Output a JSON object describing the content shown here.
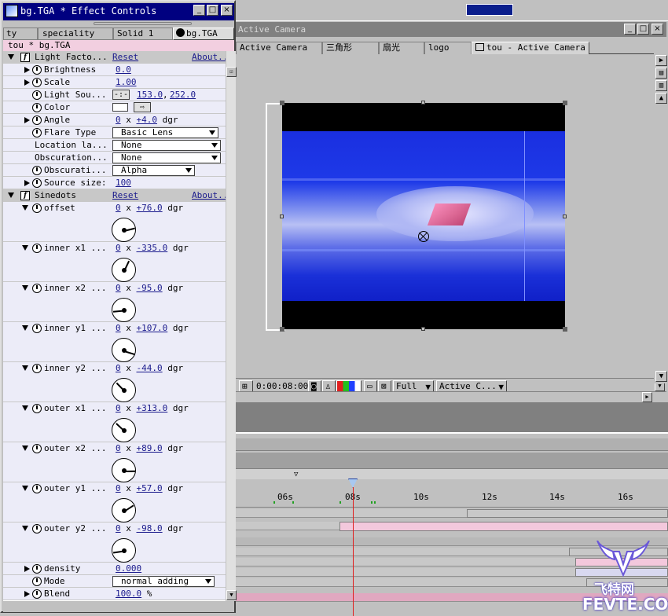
{
  "effect_controls": {
    "title": "bg.TGA * Effect Controls",
    "tabs": [
      {
        "label": "ty"
      },
      {
        "label": "speciality"
      },
      {
        "label": "Solid 1"
      },
      {
        "label": "bg.TGA"
      }
    ],
    "layer_path": "tou * bg.TGA",
    "light_factory": {
      "name": "Light Facto...",
      "reset": "Reset",
      "about": "About...",
      "params": {
        "brightness": {
          "label": "Brightness",
          "value": "0.0"
        },
        "scale": {
          "label": "Scale",
          "value": "1.00"
        },
        "light_source": {
          "label": "Light Sou...",
          "x": "153.0",
          "sep": ",",
          "y": "252.0"
        },
        "color": {
          "label": "Color",
          "value_hex": "#ffffff"
        },
        "angle": {
          "label": "Angle",
          "rev": "0",
          "x": "x",
          "deg": "+4.0",
          "unit": "dgr"
        },
        "flare_type": {
          "label": "Flare Type",
          "value": "Basic Lens"
        },
        "location_layer": {
          "label": "Location la...",
          "value": "None"
        },
        "obscuration": {
          "label": "Obscuration...",
          "value": "None"
        },
        "obscuration_type": {
          "label": "Obscurati...",
          "value": "Alpha"
        },
        "source_size": {
          "label": "Source size:",
          "value": "100"
        }
      }
    },
    "sinedots": {
      "name": "Sinedots",
      "reset": "Reset",
      "about": "About...",
      "params": [
        {
          "label": "offset",
          "rev": "0",
          "deg": "+76.0",
          "unit": "dgr",
          "angle": 76
        },
        {
          "label": "inner x1 ...",
          "rev": "0",
          "deg": "-335.0",
          "unit": "dgr",
          "angle": -335
        },
        {
          "label": "inner x2 ...",
          "rev": "0",
          "deg": "-95.0",
          "unit": "dgr",
          "angle": -95
        },
        {
          "label": "inner y1 ...",
          "rev": "0",
          "deg": "+107.0",
          "unit": "dgr",
          "angle": 107
        },
        {
          "label": "inner y2 ...",
          "rev": "0",
          "deg": "-44.0",
          "unit": "dgr",
          "angle": -44
        },
        {
          "label": "outer x1 ...",
          "rev": "0",
          "deg": "+313.0",
          "unit": "dgr",
          "angle": 313
        },
        {
          "label": "outer x2 ...",
          "rev": "0",
          "deg": "+89.0",
          "unit": "dgr",
          "angle": 89
        },
        {
          "label": "outer y1 ...",
          "rev": "0",
          "deg": "+57.0",
          "unit": "dgr",
          "angle": 57
        },
        {
          "label": "outer y2 ...",
          "rev": "0",
          "deg": "-98.0",
          "unit": "dgr",
          "angle": -98
        }
      ],
      "density": {
        "label": "density",
        "value": "0.000"
      },
      "mode": {
        "label": "Mode",
        "value": "normal adding"
      },
      "blend": {
        "label": "Blend",
        "value": "100.0",
        "unit": "%"
      }
    },
    "x_sep": "x"
  },
  "composition": {
    "title": "Active Camera",
    "tabs": [
      {
        "label": "Active Camera"
      },
      {
        "label": "三角形"
      },
      {
        "label": "扇光"
      },
      {
        "label": "logo"
      },
      {
        "label": "tou - Active Camera"
      }
    ],
    "timecode": "0:00:08:00",
    "resolution": "Full",
    "view": "Active C..."
  },
  "timeline": {
    "ruler": [
      "06s",
      "08s",
      "10s",
      "12s",
      "14s",
      "16s"
    ]
  },
  "watermark": {
    "chinese": "飞特网",
    "latin": "FEVTE.COM"
  },
  "colors": {
    "title_active": "#000080",
    "title_inactive": "#808080",
    "layer_pink": "#f3c8dc",
    "link": "#1a1a8c",
    "playhead": "#e02020"
  }
}
